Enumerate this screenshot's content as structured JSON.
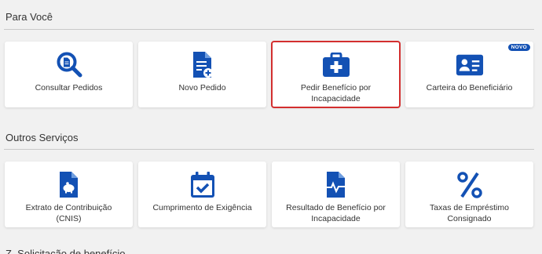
{
  "sections": {
    "para_voce": {
      "title": "Para Você",
      "cards": [
        {
          "label": "Consultar Pedidos",
          "icon": "search-document-icon"
        },
        {
          "label": "Novo Pedido",
          "icon": "new-document-icon"
        },
        {
          "label": "Pedir Benefício por Incapacidade",
          "icon": "medical-kit-icon"
        },
        {
          "label": "Carteira do Beneficiário",
          "icon": "id-card-icon",
          "badge": "NOVO"
        }
      ]
    },
    "outros_servicos": {
      "title": "Outros Serviços",
      "cards": [
        {
          "label": "Extrato de Contribuição (CNIS)",
          "icon": "piggy-bank-document-icon"
        },
        {
          "label": "Cumprimento de Exigência",
          "icon": "calendar-check-icon"
        },
        {
          "label": "Resultado de Benefício por Incapacidade",
          "icon": "health-document-icon"
        },
        {
          "label": "Taxas de Empréstimo Consignado",
          "icon": "percent-icon"
        }
      ]
    }
  },
  "footer": {
    "next_section_text": "Z. Solicitação de benefício"
  },
  "colors": {
    "icon_blue": "#1351b4",
    "selected_outline": "#d32f2f",
    "background": "#f1f1f1"
  }
}
